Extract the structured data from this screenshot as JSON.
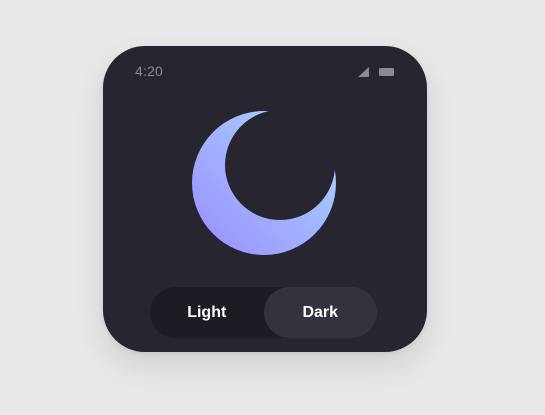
{
  "status_bar": {
    "time": "4:20",
    "signal_icon": "signal-icon",
    "battery_icon": "battery-icon"
  },
  "hero": {
    "icon": "moon-icon",
    "gradient": [
      "#a9dcff",
      "#9a8cff"
    ]
  },
  "theme_toggle": {
    "options": [
      {
        "label": "Light",
        "selected": false
      },
      {
        "label": "Dark",
        "selected": true
      }
    ]
  },
  "colors": {
    "page_background": "#e8e8e9",
    "device_background": "#262530",
    "toggle_track": "#1d1c24",
    "toggle_active": "#34333d",
    "status_text": "#8b8a93"
  }
}
